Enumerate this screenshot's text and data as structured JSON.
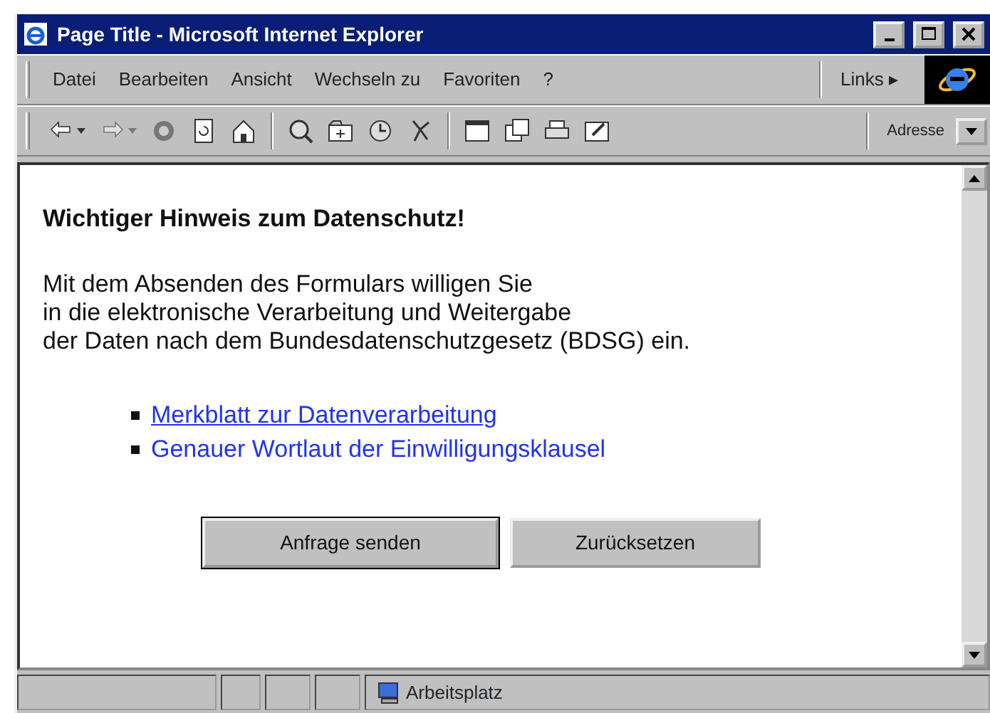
{
  "window": {
    "title": "Page Title - Microsoft Internet Explorer"
  },
  "menu": [
    "Datei",
    "Bearbeiten",
    "Ansicht",
    "Wechseln zu",
    "Favoriten",
    "?"
  ],
  "links_bar": {
    "label": "Links",
    "arrow": "▸"
  },
  "toolbar": [
    {
      "kind": "back",
      "disabled": false
    },
    {
      "kind": "forward",
      "disabled": true
    },
    {
      "kind": "stop",
      "disabled": false
    },
    {
      "kind": "refresh",
      "disabled": false
    },
    {
      "kind": "home",
      "disabled": false
    },
    {
      "kind": "sep"
    },
    {
      "kind": "search",
      "disabled": false
    },
    {
      "kind": "favorites",
      "disabled": false
    },
    {
      "kind": "history",
      "disabled": false
    },
    {
      "kind": "channels",
      "disabled": false
    },
    {
      "kind": "sep"
    },
    {
      "kind": "fullscreen",
      "disabled": false
    },
    {
      "kind": "mail",
      "disabled": false
    },
    {
      "kind": "print",
      "disabled": false
    },
    {
      "kind": "edit",
      "disabled": false
    }
  ],
  "address": {
    "label": "Adresse"
  },
  "content": {
    "heading": "Wichtiger Hinweis zum Datenschutz!",
    "lines": [
      "Mit dem Absenden des Formulars willigen Sie",
      "in die elektronische Verarbeitung und Weitergabe",
      "der Daten nach dem Bundesdatenschutzgesetz (BDSG) ein."
    ],
    "links": [
      {
        "text": "Merkblatt zur Datenverarbeitung",
        "underlined": true
      },
      {
        "text": "Genauer Wortlaut der Einwilligungsklausel",
        "underlined": false
      }
    ],
    "buttons": [
      {
        "label": "Anfrage senden",
        "default": true
      },
      {
        "label": "Zurücksetzen",
        "default": false
      }
    ]
  },
  "status_bar": {
    "zone": "Arbeitsplatz"
  }
}
